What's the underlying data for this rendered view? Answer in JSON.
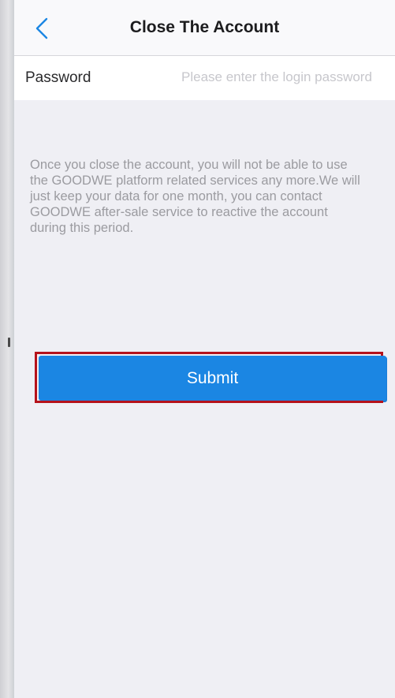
{
  "header": {
    "title": "Close The Account",
    "back_icon": "chevron-left-icon"
  },
  "password": {
    "label": "Password",
    "placeholder": "Please enter the login password",
    "value": ""
  },
  "notice": {
    "text": "Once you close the account, you will not be able to use\nthe GOODWE platform related services any more.We will\njust keep your data for one month, you can contact\nGOODWE after-sale service to reactive the account\nduring this period."
  },
  "submit": {
    "label": "Submit"
  },
  "colors": {
    "accent": "#1b86e3",
    "highlight_border": "#b5121b",
    "background": "#efeff4"
  }
}
